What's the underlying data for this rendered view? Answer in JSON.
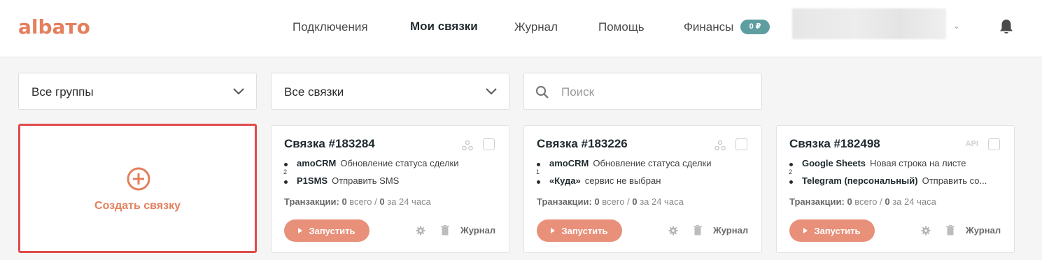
{
  "header": {
    "logo": "albaтo",
    "nav": [
      {
        "label": "Подключения",
        "active": false
      },
      {
        "label": "Мои связки",
        "active": true
      },
      {
        "label": "Журнал",
        "active": false
      },
      {
        "label": "Помощь",
        "active": false
      },
      {
        "label": "Финансы",
        "active": false
      }
    ],
    "balance_badge": "0 ₽",
    "icons": {
      "user_menu": "chevron-down-icon",
      "notifications": "bell-icon"
    }
  },
  "filters": {
    "groups": {
      "value": "Все группы"
    },
    "connections": {
      "value": "Все связки"
    },
    "search": {
      "placeholder": "Поиск",
      "value": ""
    }
  },
  "create_card": {
    "label": "Создать связку",
    "icon": "plus-circle-icon"
  },
  "cards": [
    {
      "title": "Связка #183284",
      "type_icon": "webhook-icon",
      "steps": [
        {
          "service": "amoCRM",
          "action": "Обновление статуса сделки"
        },
        {
          "service": "P1SMS",
          "action": "Отправить SMS"
        }
      ],
      "step_count": "2",
      "tx_label": "Транзакции:",
      "tx_total": "0",
      "tx_total_label": "всего /",
      "tx_day": "0",
      "tx_day_label": "за 24 часа",
      "run_label": "Запустить",
      "journal_label": "Журнал"
    },
    {
      "title": "Связка #183226",
      "type_icon": "webhook-icon",
      "steps": [
        {
          "service": "amoCRM",
          "action": "Обновление статуса сделки"
        },
        {
          "service": "«Куда»",
          "action": "сервис не выбран"
        }
      ],
      "step_count": "1",
      "tx_label": "Транзакции:",
      "tx_total": "0",
      "tx_total_label": "всего /",
      "tx_day": "0",
      "tx_day_label": "за 24 часа",
      "run_label": "Запустить",
      "journal_label": "Журнал"
    },
    {
      "title": "Связка #182498",
      "type_tag": "API",
      "steps": [
        {
          "service": "Google Sheets",
          "action": "Новая строка на листе"
        },
        {
          "service": "Telegram (персональный)",
          "action": "Отправить со..."
        }
      ],
      "step_count": "2",
      "tx_label": "Транзакции:",
      "tx_total": "0",
      "tx_total_label": "всего /",
      "tx_day": "0",
      "tx_day_label": "за 24 часа",
      "run_label": "Запустить",
      "journal_label": "Журнал"
    }
  ],
  "colors": {
    "brand": "#e47f5d",
    "run_button": "#e8907a",
    "badge": "#5f9ea0",
    "create_border": "#e04a4a"
  }
}
